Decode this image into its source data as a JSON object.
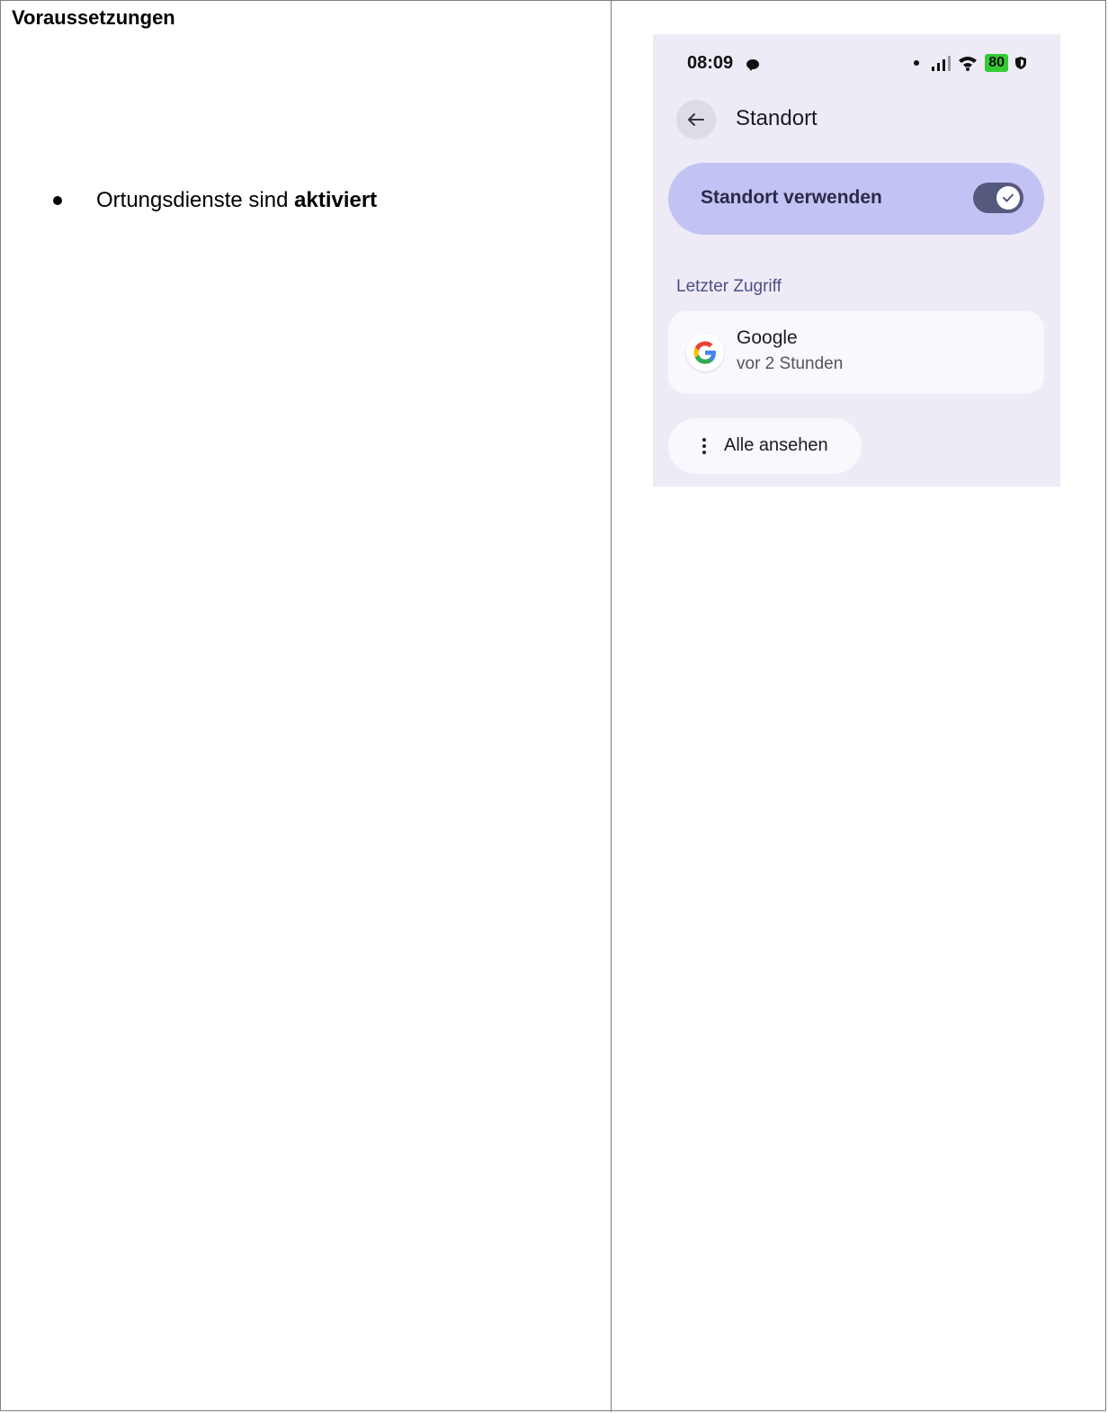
{
  "document": {
    "heading": "Voraussetzungen",
    "bullets": [
      {
        "text_before": "Ortungsdienste sind ",
        "text_bold": "aktiviert"
      }
    ]
  },
  "phone": {
    "status_bar": {
      "time": "08:09",
      "battery_level": "80",
      "battery_color": "#33cc33"
    },
    "page_title": "Standort",
    "toggle": {
      "label": "Standort verwenden",
      "checked": true
    },
    "section_label": "Letzter Zugriff",
    "recent_app": {
      "name": "Google",
      "time": "vor 2 Stunden"
    },
    "see_all_label": "Alle ansehen"
  }
}
